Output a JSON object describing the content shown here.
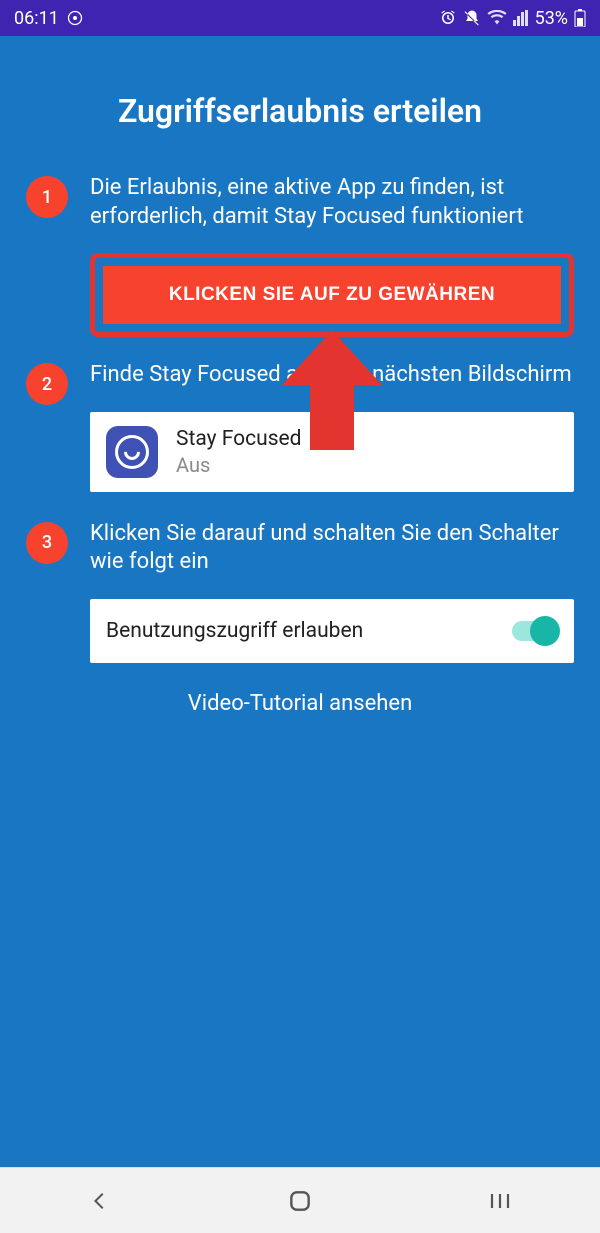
{
  "status": {
    "time": "06:11",
    "battery": "53%"
  },
  "page": {
    "title": "Zugriffserlaubnis erteilen",
    "tutorial_link": "Video-Tutorial ansehen"
  },
  "steps": {
    "one": {
      "num": "1",
      "text": "Die Erlaubnis, eine aktive App zu finden, ist erforderlich, damit Stay Focused funktioniert",
      "button": "KLICKEN SIE AUF ZU GEWÄHREN"
    },
    "two": {
      "num": "2",
      "text": "Finde Stay Focused auf dem nächsten Bildschirm",
      "app_name": "Stay Focused",
      "app_state": "Aus"
    },
    "three": {
      "num": "3",
      "text": "Klicken Sie darauf und schalten Sie den Schalter wie folgt ein",
      "toggle_label": "Benutzungszugriff erlauben",
      "toggle_on": true
    }
  }
}
